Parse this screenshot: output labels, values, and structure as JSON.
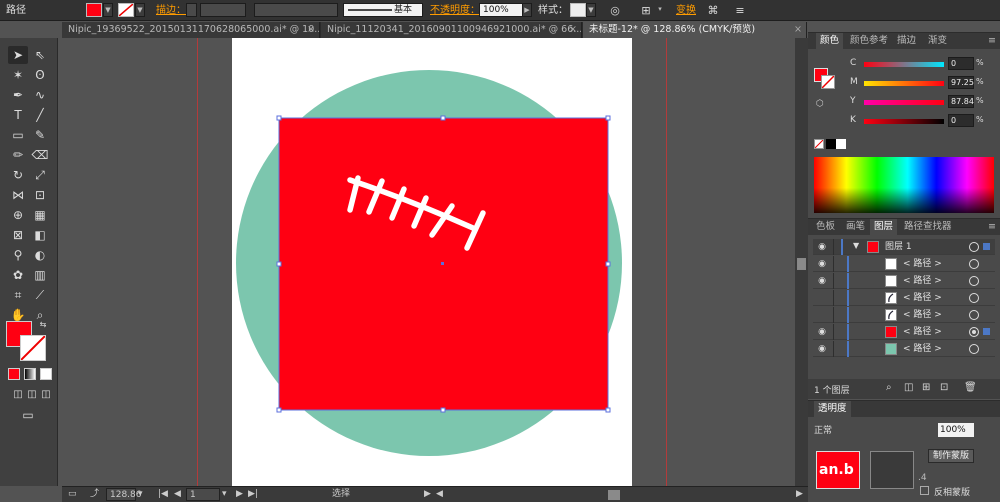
{
  "control_bar": {
    "object_type": "路径",
    "fill_color": "#ff0012",
    "stroke_label": "描边：",
    "brush_label": "基本",
    "opacity_label": "不透明度：",
    "opacity_value": "100%",
    "style_label": "样式：",
    "transform_label": "变换"
  },
  "tabs": [
    {
      "label": "Nipic_19369522_20150131170628065000.ai* @ 10...",
      "active": false
    },
    {
      "label": "Nipic_11120341_20160901100946921000.ai* @ 66...",
      "active": false
    },
    {
      "label": "未标题-12* @ 128.86% (CMYK/预览)",
      "active": true
    }
  ],
  "canvas": {
    "circle_color": "#7cc6ae",
    "square_color": "#ff0012",
    "stitch_color": "#ffffff",
    "artboard_color": "#ffffff"
  },
  "status_bar": {
    "zoom": "128.86",
    "page": "1",
    "tool_name": "选择"
  },
  "color_panel": {
    "tabs": [
      "颜色",
      "颜色参考",
      "描边",
      "渐变"
    ],
    "sliders": [
      {
        "label": "C",
        "value": "0"
      },
      {
        "label": "M",
        "value": "97.25"
      },
      {
        "label": "Y",
        "value": "87.84"
      },
      {
        "label": "K",
        "value": "0"
      }
    ],
    "percent": "%"
  },
  "layers_panel": {
    "tabs": [
      "色板",
      "画笔",
      "图层",
      "路径查找器"
    ],
    "layer_name": "图层 1",
    "items": [
      {
        "name": "< 路径 >",
        "thumb_color": "#ffffff",
        "visible": true,
        "selected": false
      },
      {
        "name": "< 路径 >",
        "thumb_color": "#ffffff",
        "visible": true,
        "selected": false
      },
      {
        "name": "< 路径 >",
        "thumb_color": "#ffffff",
        "visible": false,
        "selected": false
      },
      {
        "name": "< 路径 >",
        "thumb_color": "#ffffff",
        "visible": false,
        "selected": false
      },
      {
        "name": "< 路径 >",
        "thumb_color": "#ff0012",
        "visible": true,
        "selected": true
      },
      {
        "name": "< 路径 >",
        "thumb_color": "#7cc6ae",
        "visible": true,
        "selected": false
      }
    ],
    "footer_count": "1 个图层"
  },
  "transparency_panel": {
    "tab": "透明度",
    "blend_mode": "正常",
    "opacity": "100%",
    "make_mask": "制作蒙版",
    "invert_mask": "反相蒙版",
    "clip_hint": ".4",
    "watermark": "an.b"
  }
}
